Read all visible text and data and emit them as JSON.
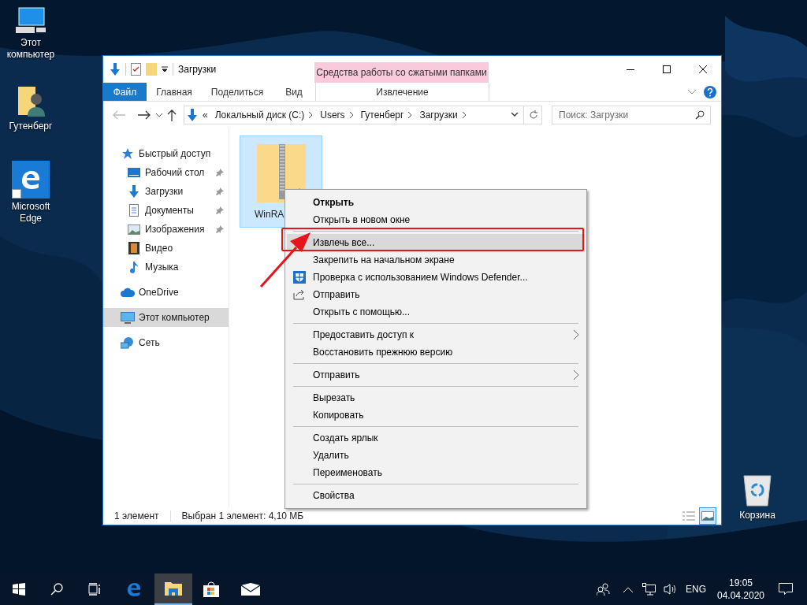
{
  "desktop_icons": [
    {
      "label": "Этот компьютер",
      "kind": "pc"
    },
    {
      "label": "Гутенберг",
      "kind": "user"
    },
    {
      "label": "Microsoft Edge",
      "kind": "edge"
    },
    {
      "label": "Корзина",
      "kind": "bin"
    }
  ],
  "window": {
    "title": "Загрузки",
    "contextual_group": "Средства работы со сжатыми папками",
    "ribbon_tabs": [
      {
        "label": "Файл",
        "kind": "file",
        "selected": false
      },
      {
        "label": "Главная",
        "kind": "tab",
        "selected": false
      },
      {
        "label": "Поделиться",
        "kind": "tab",
        "selected": false
      },
      {
        "label": "Вид",
        "kind": "tab",
        "selected": false
      },
      {
        "label": "Извлечение",
        "kind": "contextual",
        "selected": false
      }
    ],
    "address": {
      "overflow": "«",
      "segments": [
        "Локальный диск (C:)",
        "Users",
        "Гутенберг",
        "Загрузки"
      ]
    },
    "search": {
      "placeholder": "Поиск: Загрузки"
    },
    "nav": [
      {
        "label": "Быстрый доступ",
        "kind": "star",
        "selected": false,
        "children": [
          {
            "label": "Рабочий стол",
            "kind": "desktop",
            "pinned": true,
            "selected": false
          },
          {
            "label": "Загрузки",
            "kind": "downloads",
            "pinned": true,
            "selected": false
          },
          {
            "label": "Документы",
            "kind": "documents",
            "pinned": true,
            "selected": false
          },
          {
            "label": "Изображения",
            "kind": "pictures",
            "pinned": true,
            "selected": false
          },
          {
            "label": "Видео",
            "kind": "video",
            "pinned": false,
            "selected": false
          },
          {
            "label": "Музыка",
            "kind": "music",
            "pinned": false,
            "selected": false
          }
        ]
      },
      {
        "label": "OneDrive",
        "kind": "cloud",
        "selected": false
      },
      {
        "label": "Этот компьютер",
        "kind": "pc",
        "selected": true
      },
      {
        "label": "Сеть",
        "kind": "network",
        "selected": false
      }
    ],
    "files": [
      {
        "name": "WinRA",
        "selected": true
      }
    ],
    "status": {
      "count": "1 элемент",
      "selection": "Выбран 1 элемент: 4,10 МБ"
    },
    "view_buttons": [
      {
        "kind": "details",
        "selected": false
      },
      {
        "kind": "tiles",
        "selected": true
      }
    ]
  },
  "context_menu": {
    "groups": [
      [
        {
          "label": "Открыть",
          "bold": true,
          "selected": false,
          "submenu": false
        },
        {
          "label": "Открыть в новом окне",
          "bold": false,
          "selected": false,
          "submenu": false
        }
      ],
      [
        {
          "label": "Извлечь все...",
          "bold": false,
          "selected": true,
          "submenu": false
        },
        {
          "label": "Закрепить на начальном экране",
          "bold": false,
          "selected": false,
          "submenu": false
        },
        {
          "label": "Проверка с использованием Windows Defender...",
          "bold": false,
          "selected": false,
          "submenu": false,
          "kind": "shield"
        },
        {
          "label": "Отправить",
          "bold": false,
          "selected": false,
          "submenu": false,
          "kind": "share"
        },
        {
          "label": "Открыть с помощью...",
          "bold": false,
          "selected": false,
          "submenu": false
        }
      ],
      [
        {
          "label": "Предоставить доступ к",
          "bold": false,
          "selected": false,
          "submenu": true
        },
        {
          "label": "Восстановить прежнюю версию",
          "bold": false,
          "selected": false,
          "submenu": false
        }
      ],
      [
        {
          "label": "Отправить",
          "bold": false,
          "selected": false,
          "submenu": true
        }
      ],
      [
        {
          "label": "Вырезать",
          "bold": false,
          "selected": false,
          "submenu": false
        },
        {
          "label": "Копировать",
          "bold": false,
          "selected": false,
          "submenu": false
        }
      ],
      [
        {
          "label": "Создать ярлык",
          "bold": false,
          "selected": false,
          "submenu": false
        },
        {
          "label": "Удалить",
          "bold": false,
          "selected": false,
          "submenu": false
        },
        {
          "label": "Переименовать",
          "bold": false,
          "selected": false,
          "submenu": false
        }
      ],
      [
        {
          "label": "Свойства",
          "bold": false,
          "selected": false,
          "submenu": false
        }
      ]
    ]
  },
  "taskbar": {
    "apps": [
      {
        "kind": "start",
        "active": false
      },
      {
        "kind": "search",
        "active": false
      },
      {
        "kind": "taskview",
        "active": false
      },
      {
        "kind": "edge",
        "active": false
      },
      {
        "kind": "explorer",
        "active": true
      },
      {
        "kind": "store",
        "active": false
      },
      {
        "kind": "mail",
        "active": false
      }
    ],
    "tray": {
      "language": "ENG",
      "time": "19:05",
      "date": "04.04.2020"
    }
  }
}
